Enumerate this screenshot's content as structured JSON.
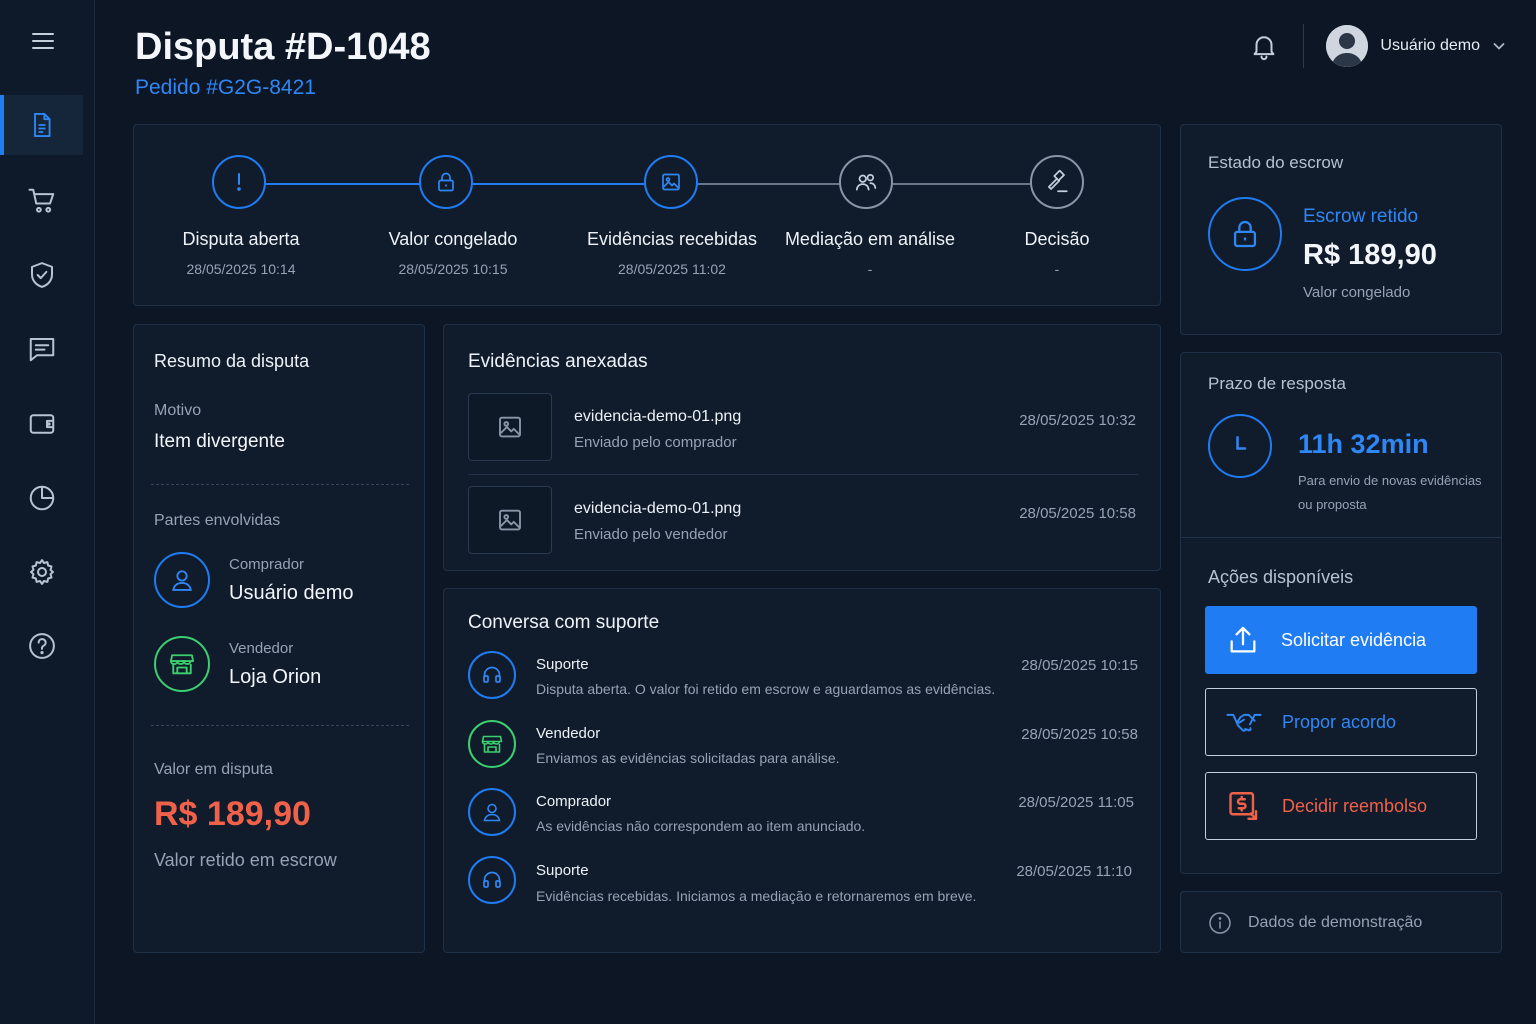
{
  "header": {
    "title": "Disputa #D-1048",
    "subtitle": "Pedido #G2G-8421",
    "user_name": "Usuário demo"
  },
  "sidebar": {
    "items": [
      {
        "name": "documents",
        "icon": "document-icon",
        "active": true
      },
      {
        "name": "orders",
        "icon": "cart-icon",
        "active": false
      },
      {
        "name": "protection",
        "icon": "shield-check-icon",
        "active": false
      },
      {
        "name": "messages",
        "icon": "chat-icon",
        "active": false
      },
      {
        "name": "wallet",
        "icon": "wallet-icon",
        "active": false
      },
      {
        "name": "reports",
        "icon": "pie-chart-icon",
        "active": false
      },
      {
        "name": "settings",
        "icon": "gear-icon",
        "active": false
      },
      {
        "name": "help",
        "icon": "help-icon",
        "active": false
      }
    ]
  },
  "timeline": {
    "steps": [
      {
        "label": "Disputa aberta",
        "date": "28/05/2025 10:14",
        "icon": "alert-icon",
        "status": "done"
      },
      {
        "label": "Valor congelado",
        "date": "28/05/2025 10:15",
        "icon": "lock-icon",
        "status": "done"
      },
      {
        "label": "Evidências recebidas",
        "date": "28/05/2025 11:02",
        "icon": "image-icon",
        "status": "done"
      },
      {
        "label": "Mediação em análise",
        "date": "-",
        "icon": "users-icon",
        "status": "pending"
      },
      {
        "label": "Decisão",
        "date": "-",
        "icon": "gavel-icon",
        "status": "pending"
      }
    ]
  },
  "summary": {
    "title": "Resumo da disputa",
    "reason_label": "Motivo",
    "reason_value": "Item divergente",
    "parties_label": "Partes envolvidas",
    "buyer_role": "Comprador",
    "buyer_name": "Usuário demo",
    "seller_role": "Vendedor",
    "seller_name": "Loja Orion",
    "amount_label": "Valor em disputa",
    "amount_value": "R$ 189,90",
    "amount_note": "Valor retido em escrow"
  },
  "evidence": {
    "title": "Evidências anexadas",
    "items": [
      {
        "file": "evidencia-demo-01.png",
        "sender": "Enviado pelo comprador",
        "time": "28/05/2025 10:32"
      },
      {
        "file": "evidencia-demo-01.png",
        "sender": "Enviado pelo vendedor",
        "time": "28/05/2025 10:58"
      }
    ]
  },
  "conversation": {
    "title": "Conversa com suporte",
    "messages": [
      {
        "author": "Suporte",
        "text": "Disputa aberta. O valor foi retido em escrow e aguardamos as evidências.",
        "time": "28/05/2025 10:15",
        "icon": "headset-icon",
        "color": "#1f7cf2"
      },
      {
        "author": "Vendedor",
        "text": "Enviamos as evidências solicitadas para análise.",
        "time": "28/05/2025 10:58",
        "icon": "store-icon",
        "color": "#3ccf6e"
      },
      {
        "author": "Comprador",
        "text": "As evidências não correspondem ao item anunciado.",
        "time": "28/05/2025 11:05",
        "icon": "user-icon",
        "color": "#1f7cf2"
      },
      {
        "author": "Suporte",
        "text": "Evidências recebidas. Iniciamos a mediação e retornaremos em breve.",
        "time": "28/05/2025 11:10",
        "icon": "headset-icon",
        "color": "#1f7cf2"
      }
    ]
  },
  "escrow": {
    "title": "Estado do escrow",
    "status": "Escrow retido",
    "amount": "R$ 189,90",
    "note": "Valor congelado"
  },
  "deadline": {
    "title": "Prazo de resposta",
    "time": "11h 32min",
    "note_line1": "Para envio de novas evidências",
    "note_line2": "ou proposta"
  },
  "actions": {
    "title": "Ações disponíveis",
    "request_evidence": "Solicitar evidência",
    "propose_agreement": "Propor acordo",
    "decide_refund": "Decidir reembolso"
  },
  "footer_note": "Dados de demonstração",
  "colors": {
    "accent": "#1f7cf2",
    "success": "#3ccf6e",
    "danger": "#f0614a",
    "background": "#0c1624",
    "card": "#101c2c"
  }
}
